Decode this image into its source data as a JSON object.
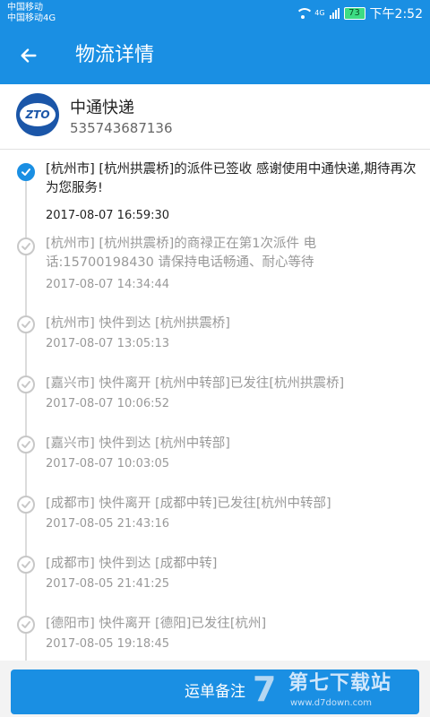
{
  "status_bar": {
    "carrier_1": "中国移动",
    "carrier_2": "中国移动4G",
    "network": "4G",
    "battery": "73",
    "time": "下午2:52"
  },
  "app_bar": {
    "title": "物流详情",
    "back_icon": "back-arrow"
  },
  "courier": {
    "logo_text": "ZTO",
    "name": "中通快递",
    "tracking_number": "535743687136"
  },
  "timeline": [
    {
      "text": "[杭州市] [杭州拱震桥]的派件已签收 感谢使用中通快递,期待再次为您服务!",
      "time": "2017-08-07 16:59:30",
      "active": true
    },
    {
      "text": "[杭州市] [杭州拱震桥]的商禄正在第1次派件 电话:15700198430 请保持电话畅通、耐心等待",
      "time": "2017-08-07 14:34:44",
      "active": false
    },
    {
      "text": "[杭州市] 快件到达 [杭州拱震桥]",
      "time": "2017-08-07 13:05:13",
      "active": false
    },
    {
      "text": "[嘉兴市] 快件离开 [杭州中转部]已发往[杭州拱震桥]",
      "time": "2017-08-07 10:06:52",
      "active": false
    },
    {
      "text": "[嘉兴市] 快件到达 [杭州中转部]",
      "time": "2017-08-07 10:03:05",
      "active": false
    },
    {
      "text": "[成都市] 快件离开 [成都中转]已发往[杭州中转部]",
      "time": "2017-08-05 21:43:16",
      "active": false
    },
    {
      "text": "[成都市] 快件到达 [成都中转]",
      "time": "2017-08-05 21:41:25",
      "active": false
    },
    {
      "text": "[德阳市] 快件离开 [德阳]已发往[杭州]",
      "time": "2017-08-05 19:18:45",
      "active": false
    }
  ],
  "bottom": {
    "remark_button": "运单备注"
  },
  "watermark": {
    "logo_glyph": "7",
    "name": "第七下载站",
    "url": "www.d7down.com"
  },
  "colors": {
    "primary": "#1a8fe3",
    "logo_blue": "#1b56a8"
  }
}
